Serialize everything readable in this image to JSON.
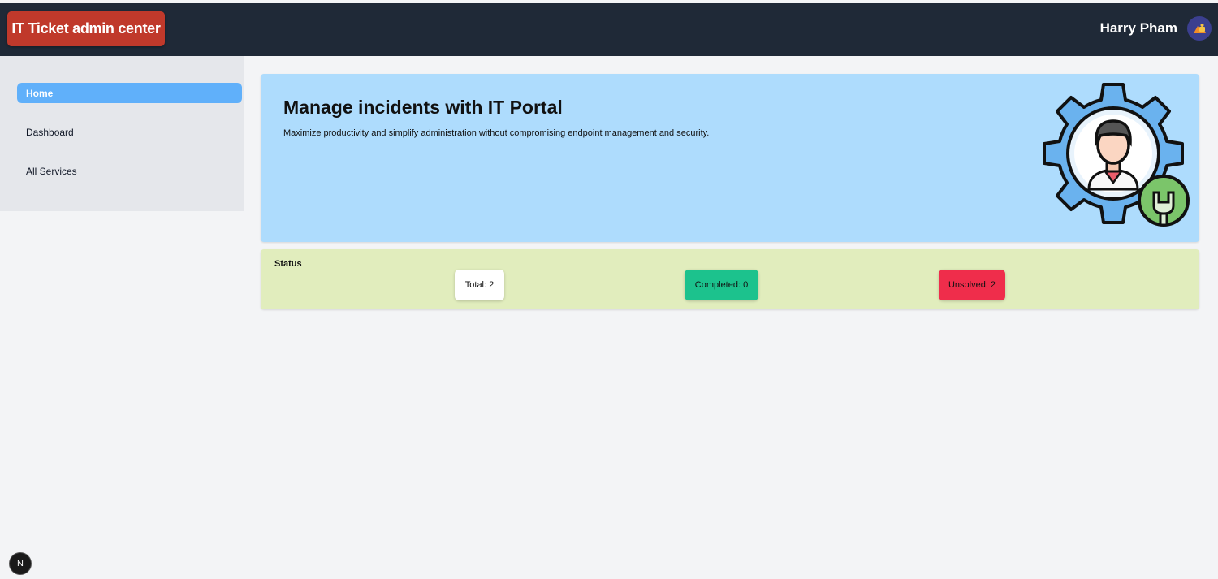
{
  "header": {
    "brand": "IT Ticket admin center",
    "user_name": "Harry Pham",
    "avatar_icon": "user-avatar-icon"
  },
  "sidebar": {
    "items": [
      {
        "label": "Home",
        "active": true
      },
      {
        "label": "Dashboard",
        "active": false
      },
      {
        "label": "All Services",
        "active": false
      }
    ]
  },
  "hero": {
    "title": "Manage incidents with IT Portal",
    "subtitle": "Maximize productivity and simplify administration without compromising endpoint management and security.",
    "illustration_icon": "gear-support-agent-icon"
  },
  "status": {
    "title": "Status",
    "total": "Total: 2",
    "completed": "Completed: 0",
    "unsolved": "Unsolved: 2"
  },
  "dev_badge": {
    "label": "N"
  },
  "colors": {
    "topbar": "#1f2937",
    "brand": "#c0392b",
    "active_nav": "#60b0fa",
    "hero_bg": "#aedcfd",
    "status_bg": "#e1edbd",
    "completed": "#1cc28d",
    "unsolved": "#ef2d4b"
  }
}
